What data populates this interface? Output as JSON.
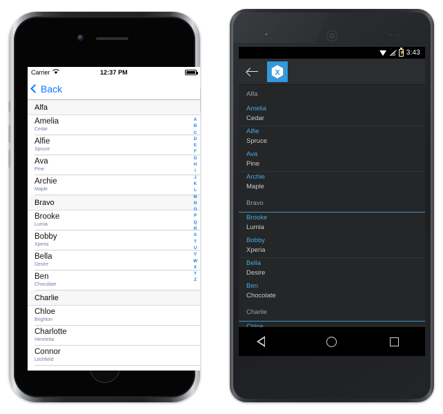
{
  "ios": {
    "status": {
      "carrier": "Carrier",
      "time": "12:37 PM",
      "wifi_icon": "wifi-icon",
      "battery_icon": "battery-icon"
    },
    "nav": {
      "back_label": "Back",
      "back_icon": "chevron-left-icon"
    },
    "accent_color": "#007aff",
    "index_letters": [
      "A",
      "B",
      "C",
      "D",
      "E",
      "F",
      "G",
      "H",
      "I",
      "J",
      "K",
      "L",
      "M",
      "N",
      "O",
      "P",
      "Q",
      "R",
      "S",
      "T",
      "U",
      "V",
      "W",
      "X",
      "Y",
      "Z"
    ],
    "rows": [
      {
        "type": "header",
        "title": "Alfa"
      },
      {
        "type": "item",
        "name": "Amelia",
        "detail": "Cedar"
      },
      {
        "type": "item",
        "name": "Alfie",
        "detail": "Spruce"
      },
      {
        "type": "item",
        "name": "Ava",
        "detail": "Pine"
      },
      {
        "type": "item",
        "name": "Archie",
        "detail": "Maple"
      },
      {
        "type": "header",
        "title": "Bravo"
      },
      {
        "type": "item",
        "name": "Brooke",
        "detail": "Lumia"
      },
      {
        "type": "item",
        "name": "Bobby",
        "detail": "Xperia"
      },
      {
        "type": "item",
        "name": "Bella",
        "detail": "Desire"
      },
      {
        "type": "item",
        "name": "Ben",
        "detail": "Chocolate"
      },
      {
        "type": "header",
        "title": "Charlie"
      },
      {
        "type": "item",
        "name": "Chloe",
        "detail": "Brighton"
      },
      {
        "type": "item",
        "name": "Charlotte",
        "detail": "Henrietta"
      },
      {
        "type": "item",
        "name": "Connor",
        "detail": "Litchfield"
      }
    ]
  },
  "android": {
    "status": {
      "clock": "3:43",
      "wifi_icon": "wifi-icon",
      "no_sim_icon": "no-signal-icon",
      "battery_icon": "battery-charging-icon"
    },
    "actionbar": {
      "back_icon": "arrow-left-icon",
      "logo_icon": "xamarin-logo-icon",
      "logo_letter": "X",
      "logo_color": "#3498db"
    },
    "accent_color": "#49a8e0",
    "rows": [
      {
        "type": "header",
        "title": "Alfa"
      },
      {
        "type": "item",
        "name": "Amelia",
        "detail": "Cedar"
      },
      {
        "type": "item",
        "name": "Alfie",
        "detail": "Spruce",
        "divider": "soft"
      },
      {
        "type": "item",
        "name": "Ava",
        "detail": "Pine"
      },
      {
        "type": "item",
        "name": "Archie",
        "detail": "Maple",
        "divider": "soft"
      },
      {
        "type": "header",
        "title": "Bravo"
      },
      {
        "type": "item",
        "name": "Brooke",
        "detail": "Lumia",
        "divider": "cyan"
      },
      {
        "type": "item",
        "name": "Bobby",
        "detail": "Xperia"
      },
      {
        "type": "item",
        "name": "Bella",
        "detail": "Desire",
        "divider": "soft"
      },
      {
        "type": "item",
        "name": "Ben",
        "detail": "Chocolate"
      },
      {
        "type": "header",
        "title": "Charlie"
      },
      {
        "type": "item",
        "name": "Chloe",
        "detail": "",
        "divider": "cyan"
      }
    ],
    "navbar": {
      "back_icon": "nav-back-triangle-icon",
      "home_icon": "nav-home-circle-icon",
      "recents_icon": "nav-recents-square-icon"
    }
  }
}
